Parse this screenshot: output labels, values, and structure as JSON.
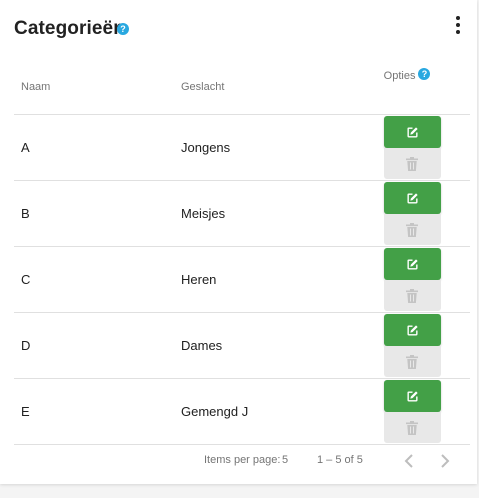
{
  "header": {
    "title": "Categorieën",
    "help_glyph": "?"
  },
  "columns": {
    "naam": "Naam",
    "geslacht": "Geslacht",
    "opties": "Opties"
  },
  "rows": [
    {
      "naam": "A",
      "geslacht": "Jongens"
    },
    {
      "naam": "B",
      "geslacht": "Meisjes"
    },
    {
      "naam": "C",
      "geslacht": "Heren"
    },
    {
      "naam": "D",
      "geslacht": "Dames"
    },
    {
      "naam": "E",
      "geslacht": "Gemengd J"
    }
  ],
  "footer": {
    "items_per_page_label": "Items per page:",
    "items_per_page_value": "5",
    "range": "1 – 5 of 5"
  },
  "icons": {
    "help": "help-icon",
    "more": "more-vert-icon",
    "edit": "edit-icon",
    "delete": "trash-icon",
    "prev": "chevron-left-icon",
    "next": "chevron-right-icon"
  },
  "colors": {
    "edit_button": "#43a047",
    "delete_button": "#e8e8e8",
    "help_icon": "#29a8e0"
  }
}
